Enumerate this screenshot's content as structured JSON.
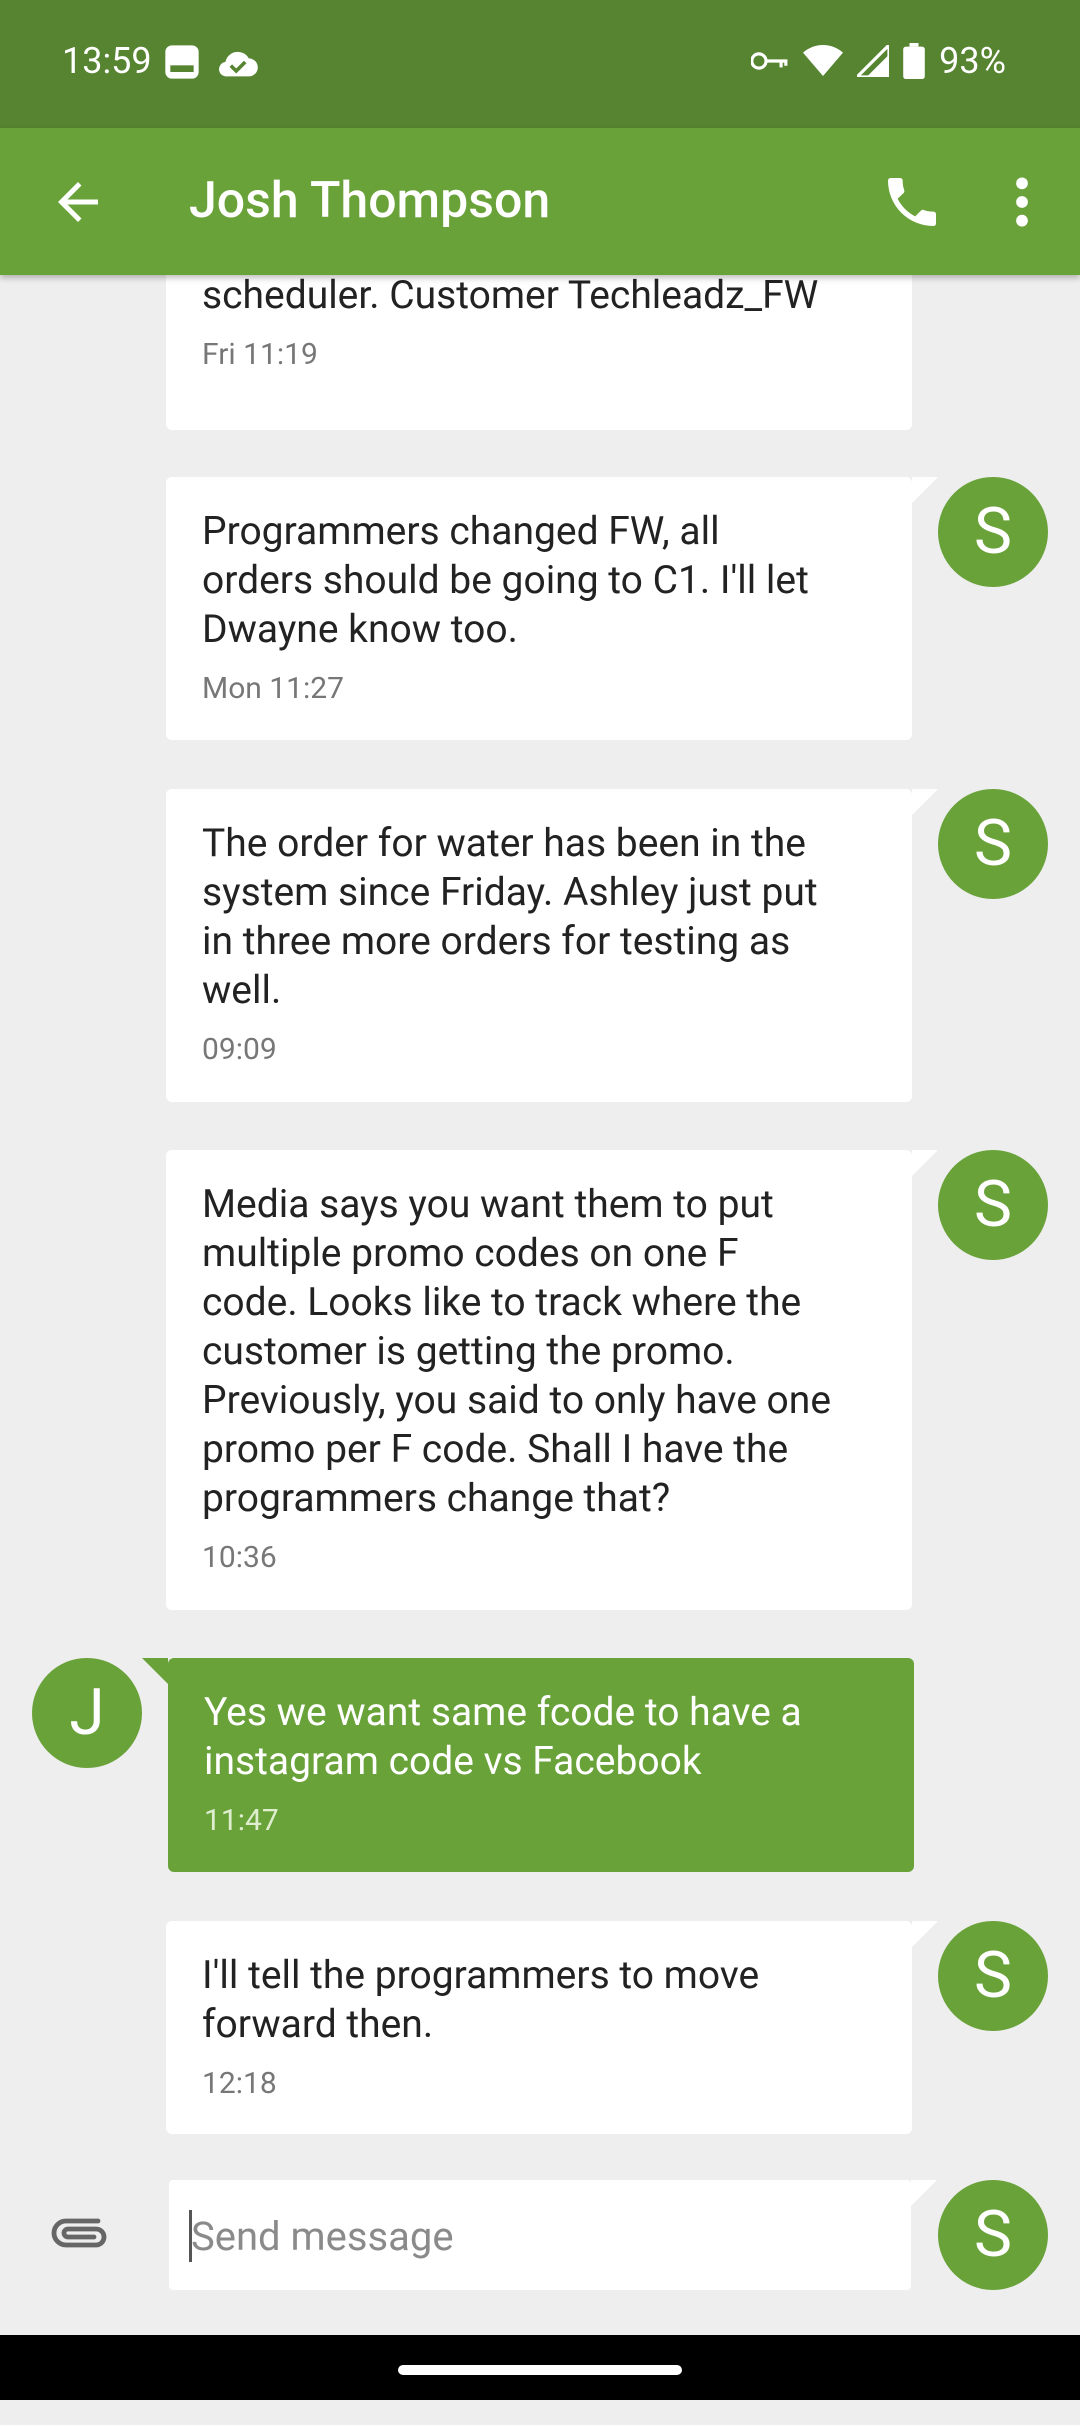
{
  "status_bar": {
    "time": "13:59",
    "battery": "93%",
    "icons": [
      "photo-icon",
      "cloud-check-icon",
      "vpn-key-icon",
      "wifi-icon",
      "signal-icon",
      "battery-icon"
    ]
  },
  "app_bar": {
    "contact_name": "Josh Thompson",
    "icons": [
      "back-arrow-icon",
      "phone-icon",
      "more-vert-icon"
    ],
    "background": "#6aa23a"
  },
  "messages": [
    {
      "direction": "outgoing",
      "text": "water. Confirmed that it's in the BM scheduler. Customer Techleadz_FW",
      "visible_text": "scheduler. Customer Techleadz_FW",
      "time": "Fri 11:19"
    },
    {
      "direction": "outgoing",
      "avatar": "S",
      "text": "Programmers changed FW, all\norders should be going to C1. I'll let\nDwayne know too.",
      "time": "Mon 11:27"
    },
    {
      "direction": "outgoing",
      "avatar": "S",
      "text": "The order for water has been in the\nsystem since Friday. Ashley just put\nin three more orders for testing as\nwell.",
      "time": "09:09"
    },
    {
      "direction": "outgoing",
      "avatar": "S",
      "text": "Media says you want them to put\nmultiple promo codes on one F\ncode. Looks like to track where the\ncustomer is getting the promo.\nPreviously, you said to only have one\npromo per F code. Shall I have the\nprogrammers change that?",
      "time": "10:36"
    },
    {
      "direction": "incoming",
      "avatar": "J",
      "text": "Yes we want same fcode to have a\ninstagram code vs Facebook",
      "time": "11:47"
    },
    {
      "direction": "outgoing",
      "avatar": "S",
      "text": "I'll tell the programmers to move\nforward then.",
      "time": "12:18"
    }
  ],
  "compose": {
    "placeholder": "Send message",
    "value": "",
    "avatar": "S"
  },
  "colors": {
    "status_bar": "#568431",
    "accent": "#6aa23a",
    "background": "#eeeeee",
    "bubble_outgoing": "#ffffff"
  }
}
